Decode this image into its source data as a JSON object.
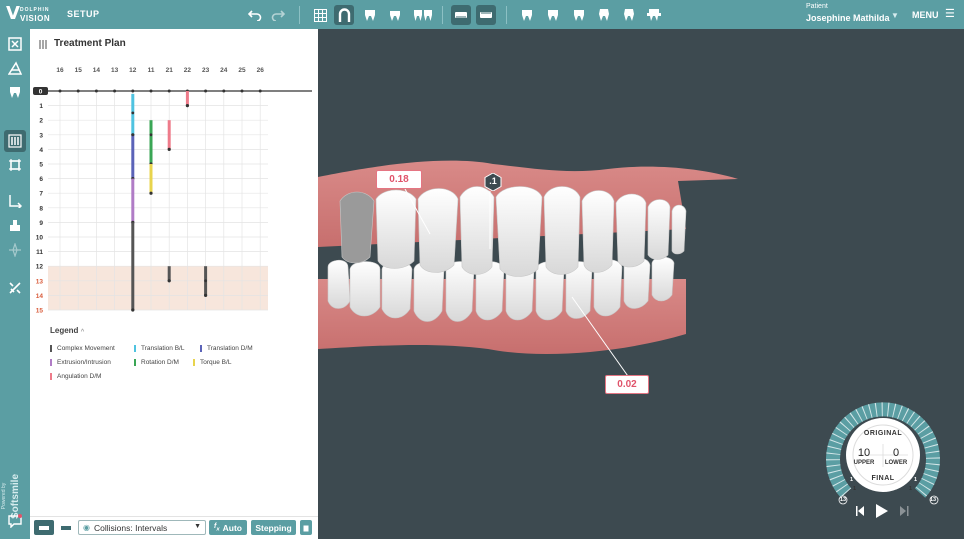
{
  "topbar": {
    "logo_brand": "DOLPHIN",
    "logo_product": "VISION",
    "logo_mark": "V",
    "setup_label": "SETUP",
    "patient_label": "Patient",
    "patient_name": "Josephine Mathilda",
    "menu_label": "MENU",
    "icons": [
      "undo-icon",
      "redo-icon",
      "grid-icon",
      "arch-icon",
      "upper-teeth-icon",
      "lower-teeth-icon",
      "both-teeth-icon",
      "aligner-upper-icon",
      "aligner-lower-icon",
      "view-front-icon",
      "view-left-icon",
      "view-right-icon",
      "view-top-icon",
      "view-bottom-icon",
      "view-back-icon"
    ]
  },
  "sidebar": {
    "items": [
      "photos-icon",
      "segmentation-icon",
      "tooth-icon",
      "treatment-plan-icon",
      "setup-icon",
      "movement-icon",
      "attachment-icon",
      "ipr-icon",
      "tools-icon",
      "chat-icon"
    ],
    "powered_by": "Powered by",
    "powered_brand": "Softsmile"
  },
  "panel": {
    "title": "Treatment Plan",
    "teeth": [
      "16",
      "15",
      "14",
      "13",
      "12",
      "11",
      "21",
      "22",
      "23",
      "24",
      "25",
      "26"
    ],
    "stages": [
      "0",
      "1",
      "2",
      "3",
      "4",
      "5",
      "6",
      "7",
      "8",
      "9",
      "10",
      "11",
      "12",
      "13",
      "14",
      "15"
    ],
    "legend_title": "Legend",
    "legend_caret": "^",
    "legend": [
      {
        "label": "Complex Movement",
        "color": "#555555"
      },
      {
        "label": "Translation B/L",
        "color": "#4fc3e0"
      },
      {
        "label": "Translation D/M",
        "color": "#5b63b8"
      },
      {
        "label": "Extrusion/Intrusion",
        "color": "#b07cc6"
      },
      {
        "label": "Rotation D/M",
        "color": "#3aa655"
      },
      {
        "label": "Torque B/L",
        "color": "#e8d44d"
      },
      {
        "label": "Angulation D/M",
        "color": "#ee7b8a"
      }
    ]
  },
  "bottom_bar": {
    "collisions_value": "Collisions: Intervals",
    "auto_label": "Auto",
    "stepping_label": "Stepping"
  },
  "viewport": {
    "measure_upper": "0.18",
    "measure_lower": "0.02",
    "marker": ".1"
  },
  "dial": {
    "original": "ORIGINAL",
    "final": "FINAL",
    "upper_value": "10",
    "lower_value": "0",
    "upper_label": "UPPER",
    "lower_label": "LOWER",
    "left_tick_top": "1",
    "left_tick_bottom": "1",
    "right_tick_top": "1",
    "right_tick_bottom": "1",
    "end_left": "13",
    "end_right": "13"
  },
  "colors": {
    "accent": "#5b9ea3",
    "accent_dark": "#3e6b70",
    "viewport_bg": "#3d4a50",
    "measure": "#e0536a"
  }
}
